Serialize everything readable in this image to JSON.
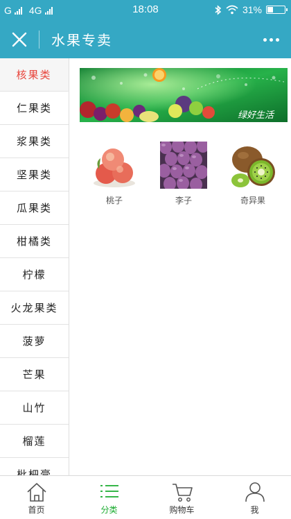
{
  "status_bar": {
    "carrier_left": "G",
    "network": "4G",
    "time": "18:08",
    "battery_text": "31%",
    "battery_level": 0.31,
    "icons": [
      "signal-icon",
      "bluetooth-icon",
      "wifi-icon",
      "battery-icon"
    ]
  },
  "header": {
    "title": "水果专卖",
    "close_icon": "close-icon",
    "more_icon": "more-icon",
    "bar_color": "#35a8c4"
  },
  "sidebar": {
    "items": [
      {
        "label": "核果类",
        "active": true
      },
      {
        "label": "仁果类"
      },
      {
        "label": "浆果类"
      },
      {
        "label": "坚果类"
      },
      {
        "label": "瓜果类"
      },
      {
        "label": "柑橘类"
      },
      {
        "label": "柠檬"
      },
      {
        "label": "火龙果类"
      },
      {
        "label": "菠萝"
      },
      {
        "label": "芒果"
      },
      {
        "label": "山竹"
      },
      {
        "label": "榴莲"
      },
      {
        "label": "枇杷膏"
      }
    ],
    "active_color": "#e8443b"
  },
  "banner": {
    "caption": "绿好生活"
  },
  "products": [
    {
      "name": "桃子",
      "image": "peach-image"
    },
    {
      "name": "李子",
      "image": "plum-image"
    },
    {
      "name": "奇异果",
      "image": "kiwi-image"
    }
  ],
  "tabbar": {
    "tabs": [
      {
        "label": "首页",
        "icon": "home-icon"
      },
      {
        "label": "分类",
        "icon": "list-icon",
        "active": true
      },
      {
        "label": "购物车",
        "icon": "cart-icon"
      },
      {
        "label": "我",
        "icon": "user-icon"
      }
    ],
    "active_color": "#1aab2f"
  }
}
